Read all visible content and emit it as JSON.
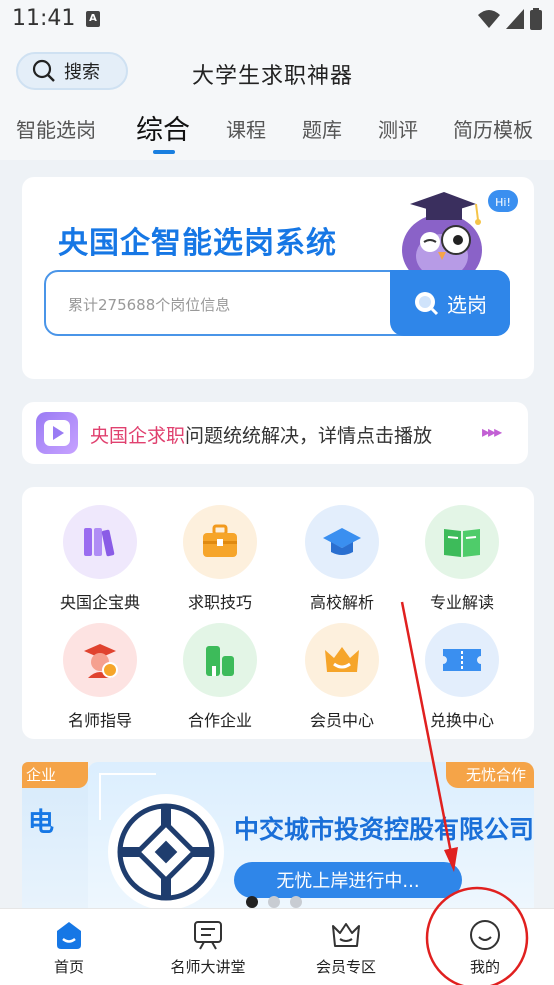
{
  "status_bar": {
    "time": "11:41",
    "notif_glyph": "A"
  },
  "header": {
    "search_label": "搜索",
    "title": "大学生求职神器"
  },
  "tabs": [
    {
      "label": "智能选岗"
    },
    {
      "label": "综合"
    },
    {
      "label": "课程"
    },
    {
      "label": "题库"
    },
    {
      "label": "测评"
    },
    {
      "label": "简历模板"
    }
  ],
  "hero": {
    "title": "央国企智能选岗系统",
    "placeholder": "累计275688个岗位信息",
    "button_label": "选岗",
    "mascot_bubble": "Hi!"
  },
  "promo": {
    "highlight": "央国企求职",
    "text": "问题统统解决，详情点击播放",
    "arrows": "▸▸▸"
  },
  "grid": [
    {
      "label": "央国企宝典",
      "icon": "books-icon",
      "bg": "#efe8fc"
    },
    {
      "label": "求职技巧",
      "icon": "briefcase-icon",
      "bg": "#fdf0dd"
    },
    {
      "label": "高校解析",
      "icon": "graduation-cap-icon",
      "bg": "#e3eefc"
    },
    {
      "label": "专业解读",
      "icon": "open-book-icon",
      "bg": "#e3f5e6"
    },
    {
      "label": "名师指导",
      "icon": "teacher-icon",
      "bg": "#fde3e2"
    },
    {
      "label": "合作企业",
      "icon": "building-icon",
      "bg": "#e3f5e6"
    },
    {
      "label": "会员中心",
      "icon": "crown-icon",
      "bg": "#fdf0dd"
    },
    {
      "label": "兑换中心",
      "icon": "ticket-icon",
      "bg": "#e3eefc"
    }
  ],
  "banner": {
    "left_tag": "企业",
    "left_char": "电",
    "tag": "无忧合作",
    "company": "中交城市投资控股有限公司",
    "pill": "无忧上岸进行中..."
  },
  "bottom_nav": [
    {
      "label": "首页",
      "icon": "home-icon"
    },
    {
      "label": "名师大讲堂",
      "icon": "lecture-icon"
    },
    {
      "label": "会员专区",
      "icon": "crown-icon"
    },
    {
      "label": "我的",
      "icon": "profile-icon"
    }
  ],
  "colors": {
    "accent": "#1677e5",
    "highlight": "#e0416f",
    "annotation": "#e0201f"
  }
}
